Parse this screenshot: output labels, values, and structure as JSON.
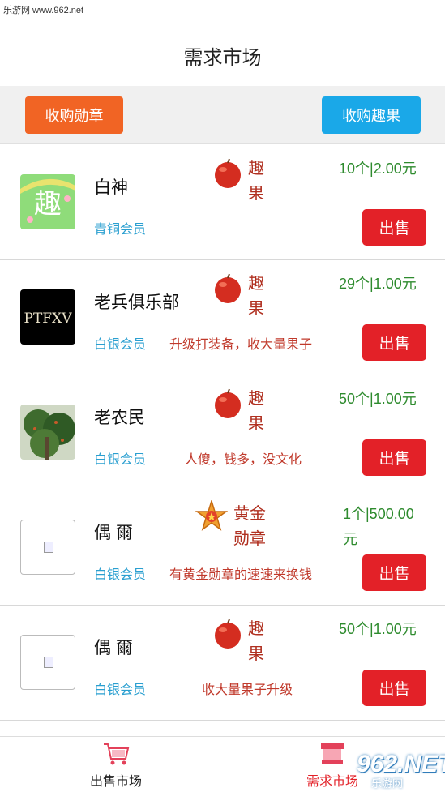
{
  "watermark": "乐游网 www.962.net",
  "header": {
    "title": "需求市场"
  },
  "actions": {
    "buy_medal": "收购勋章",
    "buy_fruit": "收购趣果"
  },
  "rows": [
    {
      "name": "白神",
      "level": "青铜会员",
      "note": "",
      "item": "趣果",
      "item_type": "apple",
      "price": "10个|2.00元",
      "sell": "出售",
      "avatar": "qu-logo"
    },
    {
      "name": "老兵俱乐部",
      "level": "白银会员",
      "note": "升级打装备，收大量果子",
      "item": "趣果",
      "item_type": "apple",
      "price": "29个|1.00元",
      "sell": "出售",
      "avatar": "ptfxv-logo",
      "avatar_text": "PTFXV"
    },
    {
      "name": "老农民",
      "level": "白银会员",
      "note": "人傻，钱多，没文化",
      "item": "趣果",
      "item_type": "apple",
      "price": "50个|1.00元",
      "sell": "出售",
      "avatar": "tree-photo"
    },
    {
      "name": "偶 爾",
      "level": "白银会员",
      "note": "有黄金勋章的速速来换钱",
      "item": "黄金勋章",
      "item_type": "gold-medal",
      "price": "1个|500.00元",
      "sell": "出售",
      "avatar": "broken-image"
    },
    {
      "name": "偶 爾",
      "level": "白银会员",
      "note": "收大量果子升级",
      "item": "趣果",
      "item_type": "apple",
      "price": "50个|1.00元",
      "sell": "出售",
      "avatar": "broken-image"
    }
  ],
  "tabs": {
    "sell_market": "出售市场",
    "demand_market": "需求市场"
  },
  "logo": {
    "number": "962.NET",
    "sub": "乐游网"
  },
  "colors": {
    "accent_red": "#e32128",
    "orange": "#f16424",
    "blue": "#1aa8e8",
    "price_green": "#2e8b2e"
  }
}
